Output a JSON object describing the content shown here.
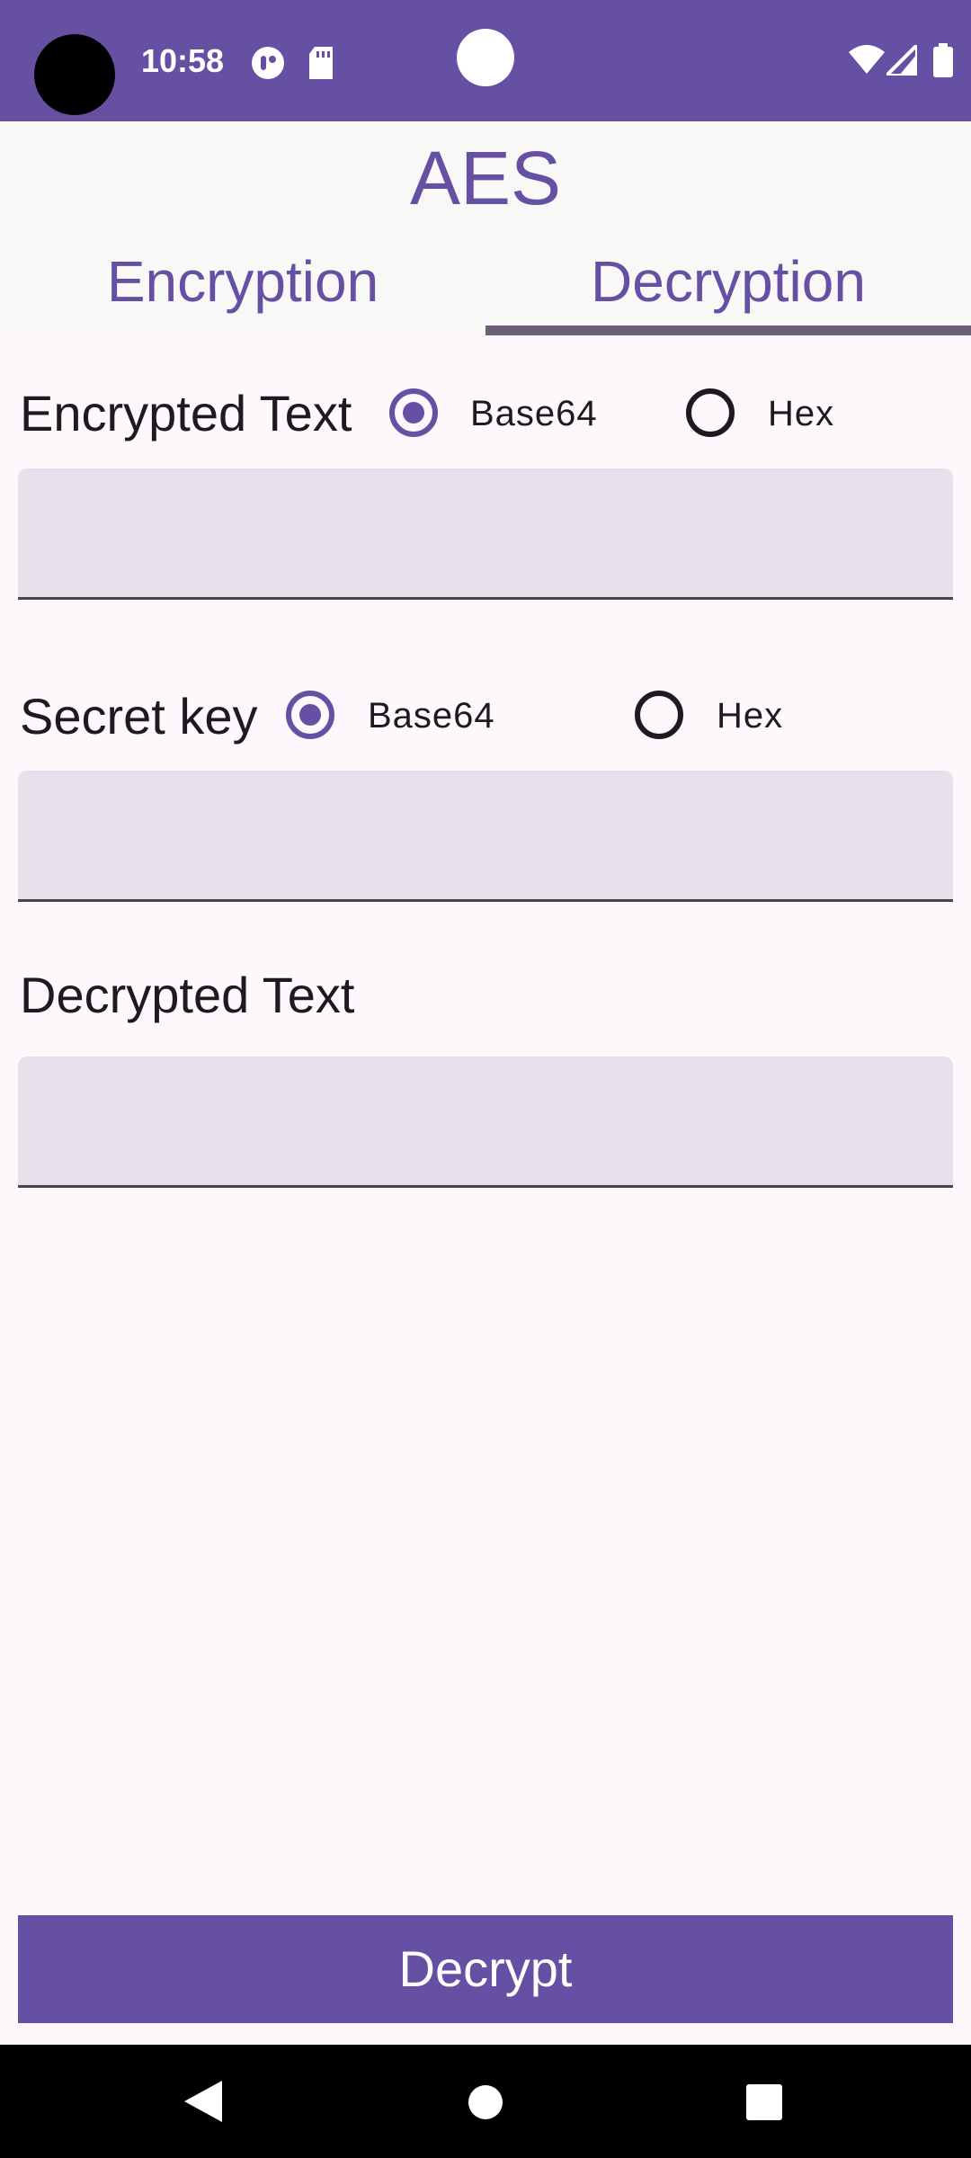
{
  "status_bar": {
    "time": "10:58",
    "icons": [
      "notification-app-icon",
      "sd-card-icon",
      "wifi-icon",
      "cellular-signal-icon",
      "battery-icon"
    ],
    "background": "#6650a4"
  },
  "app": {
    "title": "AES",
    "accent_color": "#6650a4"
  },
  "tabs": [
    {
      "label": "Encryption",
      "selected": false
    },
    {
      "label": "Decryption",
      "selected": true
    }
  ],
  "form": {
    "encrypted_text": {
      "label": "Encrypted Text",
      "options": [
        {
          "label": "Base64",
          "checked": true
        },
        {
          "label": "Hex",
          "checked": false
        }
      ],
      "value": ""
    },
    "secret_key": {
      "label": "Secret key",
      "options": [
        {
          "label": "Base64",
          "checked": true
        },
        {
          "label": "Hex",
          "checked": false
        }
      ],
      "value": ""
    },
    "decrypted_text": {
      "label": "Decrypted Text",
      "value": ""
    }
  },
  "actions": {
    "decrypt_label": "Decrypt"
  },
  "nav_bar": {
    "buttons": [
      "back-icon",
      "home-icon",
      "recents-icon"
    ]
  }
}
